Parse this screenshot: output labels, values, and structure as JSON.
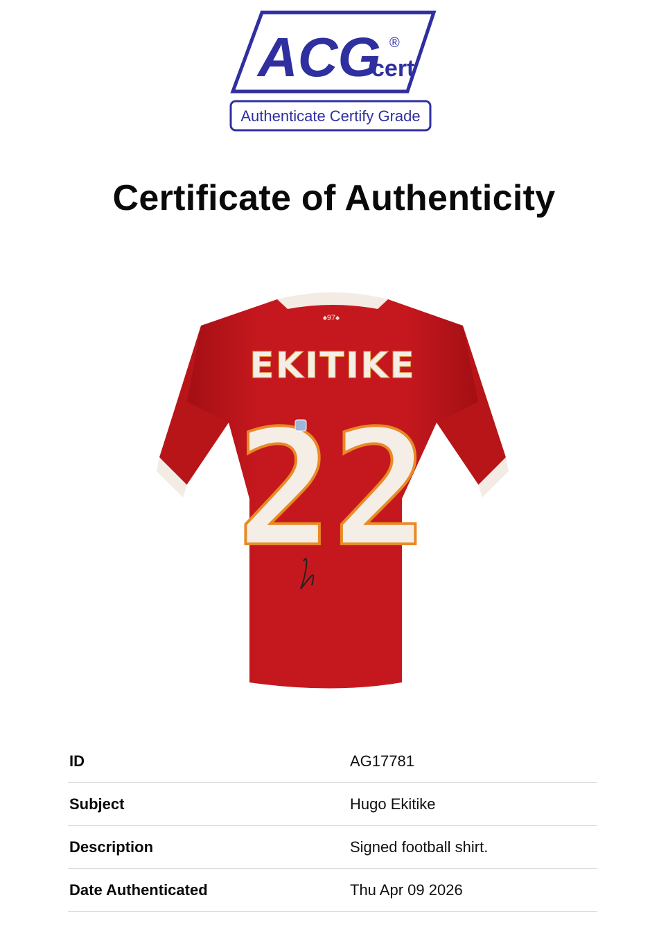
{
  "logo": {
    "brand": "ACG",
    "registered": "®",
    "suffix": "cert",
    "tagline": "Authenticate Certify Grade",
    "color": "#2f2fa0"
  },
  "title": "Certificate of Authenticity",
  "shirt": {
    "name": "EKITIKE",
    "number": "22",
    "color": "#c3161c",
    "trim": "#f2ece4"
  },
  "details": [
    {
      "label": "ID",
      "value": "AG17781"
    },
    {
      "label": "Subject",
      "value": "Hugo Ekitike"
    },
    {
      "label": "Description",
      "value": "Signed football shirt."
    },
    {
      "label": "Date Authenticated",
      "value": "Thu Apr 09 2026"
    }
  ]
}
